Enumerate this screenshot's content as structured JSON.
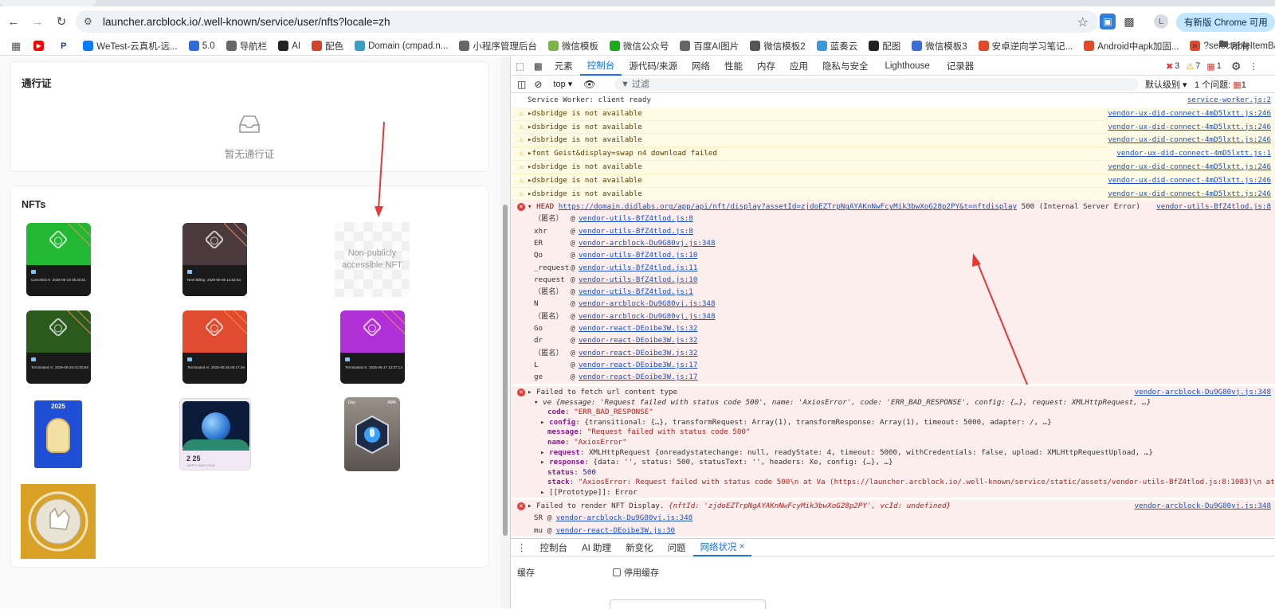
{
  "browser": {
    "url": "launcher.arcblock.io/.well-known/service/user/nfts?locale=zh",
    "profile_initial": "L",
    "update_label": "有新版 Chrome 可用",
    "bookmarks": [
      {
        "label": "WeTest-云真机-远...",
        "color": "#0a7bff"
      },
      {
        "label": "5.0",
        "color": "#2d6cdf"
      },
      {
        "label": "导航栏",
        "color": "#666"
      },
      {
        "label": "AI",
        "color": "#222"
      },
      {
        "label": "配色",
        "color": "#d0442c"
      },
      {
        "label": "Domain (cmpad.n...",
        "color": "#35a0c9"
      },
      {
        "label": "小程序管理后台",
        "color": "#666"
      },
      {
        "label": "微信模板",
        "color": "#7bb24a"
      },
      {
        "label": "微信公众号",
        "color": "#1aad19"
      },
      {
        "label": "百度AI图片",
        "color": "#666"
      },
      {
        "label": "微信模板2",
        "color": "#555"
      },
      {
        "label": "蓝奏云",
        "color": "#3a9ad9"
      },
      {
        "label": "配图",
        "color": "#222"
      },
      {
        "label": "微信模板3",
        "color": "#3c6fd6"
      },
      {
        "label": "安卓逆向学习笔记...",
        "color": "#e04a2b"
      },
      {
        "label": "Android中apk加固...",
        "color": "#e04a2b"
      },
      {
        "label": "?selectableItemBa...",
        "color": "#e04a2b"
      }
    ],
    "bookmarks_more": "»",
    "all_bookmarks": "所有"
  },
  "page": {
    "pass_title": "通行证",
    "pass_empty": "暂无通行证",
    "nfts_title": "NFTs",
    "non_public": "Non-publicly accessible NFT",
    "nfts": [
      {
        "color": "#22b833",
        "status": "Canceled AI",
        "date": "2025-06-10 05:30:51"
      },
      {
        "color": "#4a3a3e",
        "status": "Neel Billing",
        "date": "2025-06-08 12:52:53"
      },
      {
        "color": "#2a5a1e",
        "status": "Terminated AI",
        "date": "2025-05-26 01:00:58"
      },
      {
        "color": "#e04a2e",
        "status": "Terminated AI",
        "date": "2025-05-26 06:17:49"
      },
      {
        "color": "#b12fd6",
        "status": "Terminated AI",
        "date": "2025-06-17 12:07:13"
      }
    ],
    "stamp_year": "2025",
    "card_year": "2 25",
    "card_label": "HAPPY NEW YEAR",
    "gem_top_left": "Day",
    "gem_top_right": "AMA"
  },
  "devtools": {
    "tabs": [
      "元素",
      "控制台",
      "源代码/来源",
      "网络",
      "性能",
      "内存",
      "应用",
      "隐私与安全",
      "Lighthouse",
      "记录器"
    ],
    "active_tab": "控制台",
    "errors": "3",
    "warnings": "7",
    "issues_badge": "1",
    "context": "top",
    "filter_placeholder": "过滤",
    "level": "默认级别",
    "issues_text": "1 个问题:",
    "issues_count": "1",
    "messages": [
      {
        "type": "info",
        "text": "Service Worker: client ready",
        "src": "service-worker.js:2"
      },
      {
        "type": "warn",
        "text": "dsbridge is not available",
        "src": "vendor-ux-did-connect-4mD5lxtt.js:246"
      },
      {
        "type": "warn",
        "text": "dsbridge is not available",
        "src": "vendor-ux-did-connect-4mD5lxtt.js:246"
      },
      {
        "type": "warn",
        "text": "dsbridge is not available",
        "src": "vendor-ux-did-connect-4mD5lxtt.js:246"
      },
      {
        "type": "warn",
        "text": "font Geist&display=swap n4 download failed",
        "src": "vendor-ux-did-connect-4mD5lxtt.js:1"
      },
      {
        "type": "warn",
        "text": "dsbridge is not available",
        "src": "vendor-ux-did-connect-4mD5lxtt.js:246"
      },
      {
        "type": "warn",
        "text": "dsbridge is not available",
        "src": "vendor-ux-did-connect-4mD5lxtt.js:246"
      },
      {
        "type": "warn",
        "text": "dsbridge is not available",
        "src": "vendor-ux-did-connect-4mD5lxtt.js:246"
      }
    ],
    "head_error": {
      "method": "HEAD",
      "url": "https://domain.didlabs.org/app/api/nft/display?assetId=zjdoEZTrpNgAYAKnNwFcyMik3bwXoG28p2PY&t=nftdisplay",
      "status": "500 (Internal Server Error)",
      "src": "vendor-utils-BfZ4tlod.js:8"
    },
    "stack": [
      {
        "fn": "（匿名）",
        "src": "vendor-utils-BfZ4tlod.js:8"
      },
      {
        "fn": "xhr",
        "src": "vendor-utils-BfZ4tlod.js:8"
      },
      {
        "fn": "ER",
        "src": "vendor-arcblock-Du9G80vj.js:348"
      },
      {
        "fn": "Qo",
        "src": "vendor-utils-BfZ4tlod.js:10"
      },
      {
        "fn": "_request",
        "src": "vendor-utils-BfZ4tlod.js:11"
      },
      {
        "fn": "request",
        "src": "vendor-utils-BfZ4tlod.js:10"
      },
      {
        "fn": "（匿名）",
        "src": "vendor-utils-BfZ4tlod.js:1"
      },
      {
        "fn": "N",
        "src": "vendor-arcblock-Du9G80vj.js:348"
      },
      {
        "fn": "（匿名）",
        "src": "vendor-arcblock-Du9G80vj.js:348"
      },
      {
        "fn": "Go",
        "src": "vendor-react-DEoibe3W.js:32"
      },
      {
        "fn": "dr",
        "src": "vendor-react-DEoibe3W.js:32"
      },
      {
        "fn": "（匿名）",
        "src": "vendor-react-DEoibe3W.js:32"
      },
      {
        "fn": "L",
        "src": "vendor-react-DEoibe3W.js:17"
      },
      {
        "fn": "ge",
        "src": "vendor-react-DEoibe3W.js:17"
      }
    ],
    "fetch_error": {
      "text": "Failed to fetch url content type",
      "src": "vendor-arcblock-Du9G80vj.js:348",
      "summary": "ve  {message: 'Request failed with status code 500', name: 'AxiosError', code: 'ERR_BAD_RESPONSE', config: {…}, request: XMLHttpRequest, …}",
      "code": "\"ERR_BAD_RESPONSE\"",
      "config": "{transitional: {…}, transformRequest: Array(1), transformResponse: Array(1), timeout: 5000, adapter: /, …}",
      "message": "\"Request failed with status code 500\"",
      "name": "\"AxiosError\"",
      "request": "XMLHttpRequest  {onreadystatechange: null, readyState: 4, timeout: 5000, withCredentials: false, upload: XMLHttpRequestUpload, …}",
      "response": "{data: '', status: 500, statusText: '', headers: Xe, config: {…}, …}",
      "status": "500",
      "stack": "\"AxiosError: Request failed with status code 500\\n    at Va (https://launcher.arcblock.io/.well-known/service/static/assets/vendor-utils-BfZ4tlod.js:8:1083)\\n    at XMLH",
      "prototype": "[[Prototype]]: Error"
    },
    "render_error": {
      "text": "Failed to render NFT Display.",
      "detail": "{nftId: 'zjdoEZTrpNgAYAKnNwFcyMik3bwXoG28p2PY', vcId: undefined}",
      "src": "vendor-arcblock-Du9G80vj.js:348",
      "frames": [
        {
          "fn": "SR",
          "src": "vendor-arcblock-Du9G80vj.js:348"
        },
        {
          "fn": "mu",
          "src": "vendor-react-DEoibe3W.js:30"
        }
      ]
    },
    "drawer_tabs": [
      "控制台",
      "AI 助理",
      "新变化",
      "问题",
      "网络状况"
    ],
    "drawer_active": "网络状况",
    "cache_label": "缓存",
    "disable_cache": "停用缓存"
  }
}
